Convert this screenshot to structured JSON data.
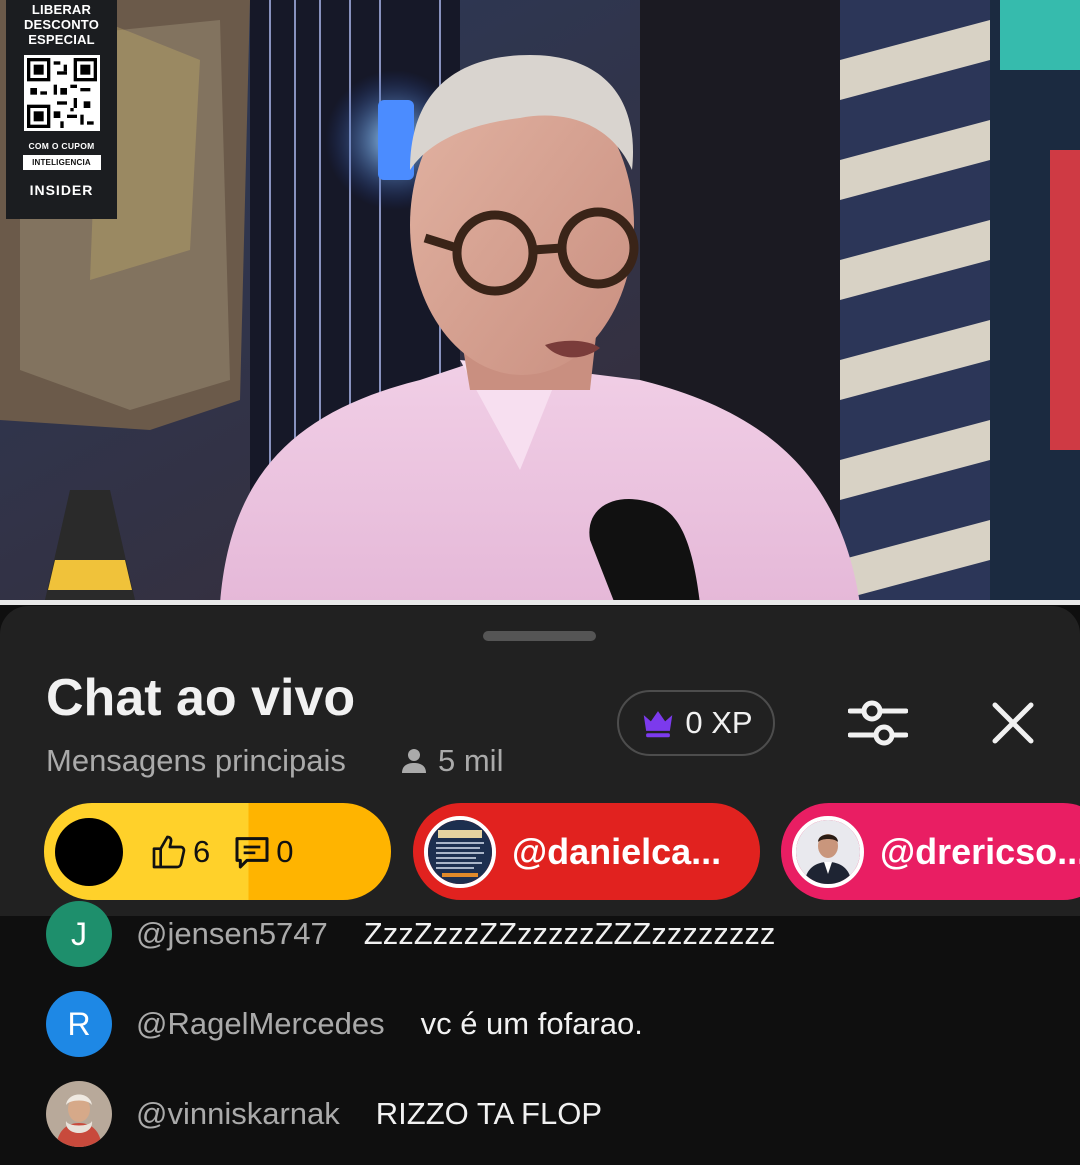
{
  "video": {
    "promo": {
      "line1": "LIBERAR",
      "line2": "DESCONTO",
      "line3": "ESPECIAL",
      "coupon_prefix": "COM O CUPOM",
      "coupon_code": "INTELIGENCIA",
      "brand": "INSIDER"
    }
  },
  "chat": {
    "title": "Chat ao vivo",
    "mode": "Mensagens principais",
    "viewer_count": "5 mil",
    "xp_label": "0 XP",
    "pinned": [
      {
        "likes": "6",
        "comments": "0",
        "color": "#ffd12a"
      },
      {
        "handle": "@danielca...",
        "color": "#e1221f"
      },
      {
        "handle": "@drericso...",
        "color": "#e91e63"
      }
    ],
    "messages": [
      {
        "initial": "J",
        "author": "@jensen5747",
        "text": "ZzzZzzzZZzzzzzZZZzzzzzzzz",
        "avatar_color": "#1e8f6c"
      },
      {
        "initial": "R",
        "author": "@RagelMercedes",
        "text": "vc é um fofarao.",
        "avatar_color": "#1e88e5"
      },
      {
        "initial": "",
        "author": "@vinniskarnak",
        "text": "RIZZO TA FLOP",
        "avatar_color": "#8a7b6e"
      }
    ]
  }
}
